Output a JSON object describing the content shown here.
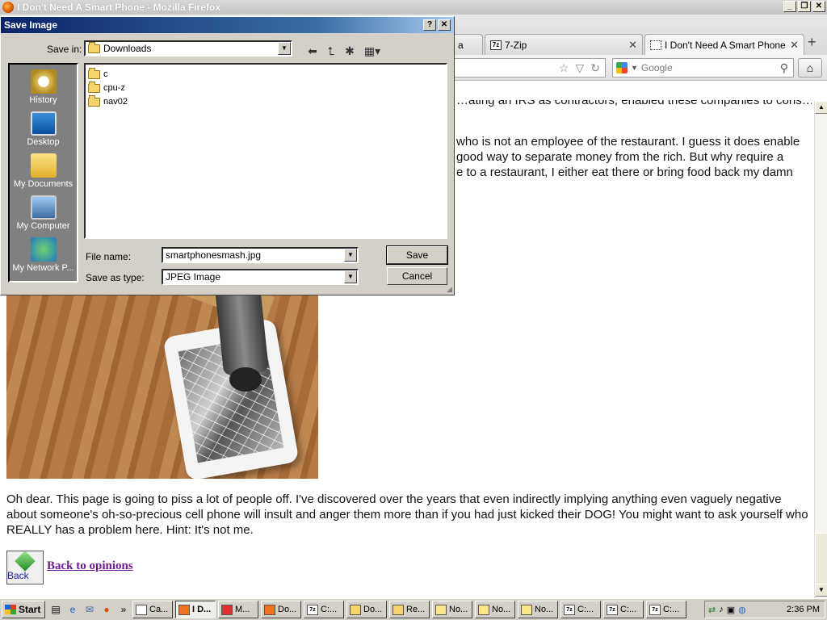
{
  "window": {
    "title": "I Don't Need A Smart Phone - Mozilla Firefox",
    "min": "_",
    "max": "❐",
    "close": "✕"
  },
  "tabs": [
    {
      "label": "a",
      "icon": "page-icon"
    },
    {
      "label": "7-Zip",
      "icon": "7zip-icon"
    },
    {
      "label": "I Don't Need A Smart Phone",
      "icon": "page-icon"
    }
  ],
  "search": {
    "placeholder": "Google"
  },
  "page": {
    "partial_top": "…ating an IRS as contractors, enabled these companies to cons…",
    "partial_mid_1": "who is not an employee of the restaurant. I guess it does enable",
    "partial_mid_2": "good way to separate money from the rich. But why require a",
    "partial_mid_3": "e to a restaurant, I either eat there or bring food back my damn",
    "paragraph": "Oh dear. This page is going to piss a lot of people off. I've discovered over the years that even indirectly implying anything even vaguely negative about someone's oh-so-precious cell phone will insult and anger them more than if you had just kicked their DOG! You might want to ask yourself who REALLY has a problem here. Hint: It's not me.",
    "back_icon_label": "Back",
    "back_link": "Back to opinions"
  },
  "dialog": {
    "title": "Save Image",
    "help": "?",
    "close": "✕",
    "save_in_label": "Save in:",
    "save_in_value": "Downloads",
    "places": [
      "History",
      "Desktop",
      "My Documents",
      "My Computer",
      "My Network P..."
    ],
    "files": [
      "c",
      "cpu-z",
      "nav02"
    ],
    "file_name_label": "File name:",
    "file_name_value": "smartphonesmash.jpg",
    "save_as_type_label": "Save as type:",
    "save_as_type_value": "JPEG Image",
    "save_button": "Save",
    "cancel_button": "Cancel"
  },
  "taskbar": {
    "start": "Start",
    "tasks": [
      "Ca...",
      "I D...",
      "M...",
      "Do...",
      "C:...",
      "Do...",
      "Re...",
      "No...",
      "No...",
      "No...",
      "C:...",
      "C:...",
      "C:..."
    ],
    "clock": "2:36 PM"
  }
}
